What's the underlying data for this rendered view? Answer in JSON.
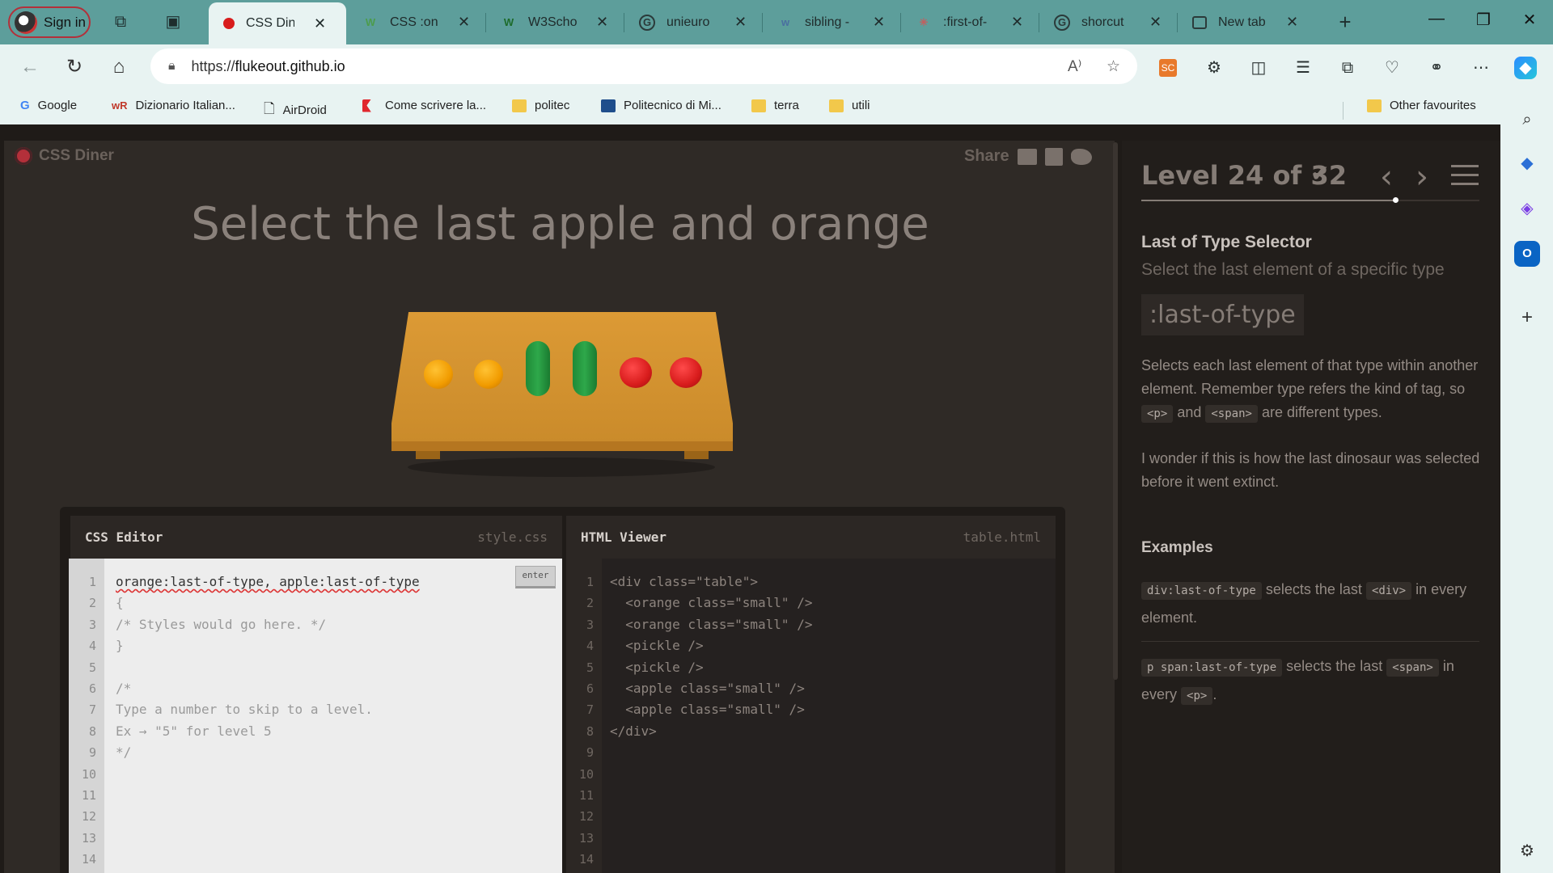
{
  "browser": {
    "signin_label": "Sign in",
    "tabs": [
      {
        "label": "CSS Din",
        "icon": "red-dot-icon",
        "active": true
      },
      {
        "label": "CSS :onl",
        "icon": "w3-icon"
      },
      {
        "label": "W3Scho",
        "icon": "w3-icon"
      },
      {
        "label": "unieuro",
        "icon": "google-icon"
      },
      {
        "label": "sibling -",
        "icon": "w-icon"
      },
      {
        "label": ":first-of-",
        "icon": "star-icon"
      },
      {
        "label": "shorcut",
        "icon": "google-icon"
      },
      {
        "label": "New tab",
        "icon": "new-tab-icon"
      }
    ],
    "new_tab_label": "+",
    "window": {
      "minimize": "—",
      "maximize": "❐",
      "close": "✕"
    },
    "url_scheme": "https://",
    "url_host": "flukeout.github.io",
    "bookmarks": [
      {
        "label": "Google",
        "icon": "google-icon"
      },
      {
        "label": "Dizionario Italian...",
        "icon": "wr-icon"
      },
      {
        "label": "AirDroid",
        "icon": "page-icon"
      },
      {
        "label": "Come scrivere la...",
        "icon": "k-icon"
      },
      {
        "label": "politec",
        "icon": "folder-icon"
      },
      {
        "label": "Politecnico di Mi...",
        "icon": "polimi-icon"
      },
      {
        "label": "terra",
        "icon": "folder-icon"
      },
      {
        "label": "utili",
        "icon": "folder-icon"
      }
    ],
    "other_favourites": "Other favourites"
  },
  "app": {
    "name": "CSS Diner",
    "share_label": "Share",
    "order": "Select the last apple and orange",
    "plates": [
      "orange",
      "orange",
      "pickle",
      "pickle",
      "apple",
      "apple"
    ]
  },
  "css_editor": {
    "title": "CSS Editor",
    "file": "style.css",
    "enter_label": "enter",
    "lines": [
      "orange:last-of-type, apple:last-of-type",
      "{",
      "/* Styles would go here. */",
      "}",
      "",
      "/*",
      "Type a number to skip to a level.",
      "Ex → \"5\" for level 5",
      "*/",
      "",
      "",
      "",
      "",
      ""
    ],
    "line_numbers": [
      "1",
      "2",
      "3",
      "4",
      "5",
      "6",
      "7",
      "8",
      "9",
      "10",
      "11",
      "12",
      "13",
      "14"
    ]
  },
  "html_viewer": {
    "title": "HTML Viewer",
    "file": "table.html",
    "lines": [
      "<div class=\"table\">",
      "  <orange class=\"small\" />",
      "  <orange class=\"small\" />",
      "  <pickle />",
      "  <pickle />",
      "  <apple class=\"small\" />",
      "  <apple class=\"small\" />",
      "</div>",
      "",
      "",
      "",
      "",
      "",
      ""
    ],
    "line_numbers": [
      "1",
      "2",
      "3",
      "4",
      "5",
      "6",
      "7",
      "8",
      "9",
      "10",
      "11",
      "12",
      "13",
      "14"
    ]
  },
  "level": {
    "label": "Level 24 of 32",
    "current": 24,
    "total": 32,
    "completed": true,
    "selector_name": "Last of Type Selector",
    "selector_hint": "Select the last element of a specific type",
    "syntax": ":last-of-type",
    "desc_1_part1": "Selects each last element of that type within another element. Remember type refers the kind of tag, so",
    "desc_tag_p": "<p>",
    "desc_and": "and",
    "desc_tag_span": "<span>",
    "desc_1_part2": "are different types.",
    "desc_2": "I wonder if this is how the last dinosaur was selected before it went extinct.",
    "examples_title": "Examples",
    "ex1_code": "div:last-of-type",
    "ex1_text_a": "selects the last",
    "ex1_tag": "<div>",
    "ex1_text_b": "in every element.",
    "ex2_code": "p span:last-of-type",
    "ex2_text_a": "selects the last",
    "ex2_tag": "<span>",
    "ex2_text_b": "in every",
    "ex2_tag2": "<p>",
    "ex2_end": "."
  }
}
